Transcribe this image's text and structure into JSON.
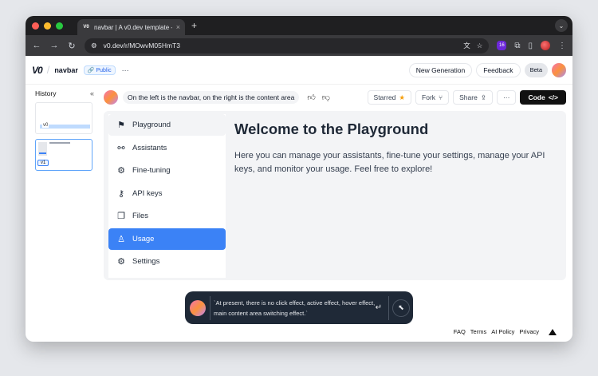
{
  "browser": {
    "tab_title": "navbar | A v0.dev template -",
    "tab_close": "×",
    "new_tab": "+",
    "url": "v0.dev/r/MOwvM05HmT3",
    "ext_badge": "16",
    "traffic_lights": [
      "#ff5f57",
      "#febc2e",
      "#28c840"
    ]
  },
  "header": {
    "logo": "V0",
    "project_name": "navbar",
    "visibility": "Public",
    "more": "···",
    "new_generation": "New Generation",
    "feedback": "Feedback",
    "beta": "Beta"
  },
  "history": {
    "title": "History",
    "collapse": "«",
    "versions": [
      "v0",
      "v1"
    ]
  },
  "prompt": {
    "text": "On the left is the navbar, on the right is the content area"
  },
  "actions": {
    "starred": "Starred",
    "fork": "Fork",
    "share": "Share",
    "more": "···",
    "code": "Code"
  },
  "preview": {
    "nav_items": [
      {
        "label": "Playground",
        "icon": "flag-icon"
      },
      {
        "label": "Assistants",
        "icon": "link-icon"
      },
      {
        "label": "Fine-tuning",
        "icon": "gear-icon"
      },
      {
        "label": "API keys",
        "icon": "key-icon"
      },
      {
        "label": "Files",
        "icon": "file-icon"
      },
      {
        "label": "Usage",
        "icon": "user-icon"
      },
      {
        "label": "Settings",
        "icon": "settings-icon"
      }
    ],
    "active_item": "Usage",
    "heading": "Welcome to the Playground",
    "body": "Here you can manage your assistants, fine-tune your settings, manage your API keys, and monitor your usage. Feel free to explore!",
    "accent_color": "#3b82f6"
  },
  "chat": {
    "text": "`At present, there is no click effect, active effect, hover effect, main content area switching effect.`"
  },
  "footer": {
    "links": [
      "FAQ",
      "Terms",
      "AI Policy",
      "Privacy"
    ]
  }
}
